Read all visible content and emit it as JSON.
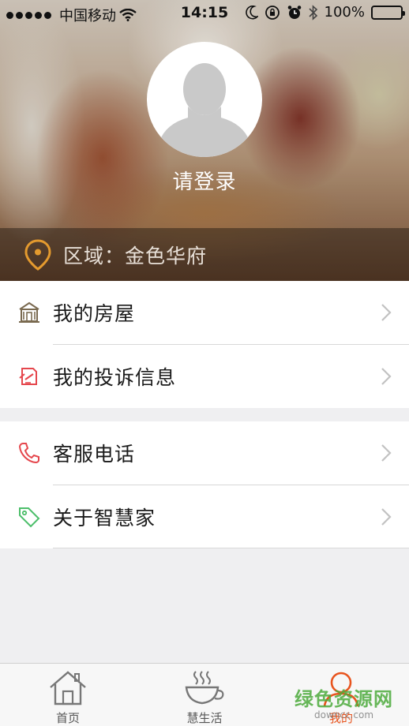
{
  "status_bar": {
    "carrier": "中国移动",
    "time": "14:15",
    "battery": "100%",
    "icons": [
      "signal-dots-icon",
      "wifi-icon",
      "moon-icon",
      "rotation-lock-icon",
      "alarm-icon",
      "bluetooth-icon",
      "battery-icon"
    ]
  },
  "profile": {
    "login_label": "请登录",
    "avatar_icon": "default-avatar-icon"
  },
  "region": {
    "label": "区域：金色华府",
    "icon": "location-pin-icon",
    "icon_color": "#e49a2e"
  },
  "menu_groups": [
    {
      "items": [
        {
          "label": "我的房屋",
          "icon": "house-icon"
        },
        {
          "label": "我的投诉信息",
          "icon": "complaint-note-icon"
        }
      ]
    },
    {
      "items": [
        {
          "label": "客服电话",
          "icon": "phone-icon"
        },
        {
          "label": "关于智慧家",
          "icon": "tag-icon"
        }
      ]
    }
  ],
  "tab_bar": {
    "tabs": [
      {
        "label": "首页",
        "icon": "home-icon",
        "active": false
      },
      {
        "label": "慧生活",
        "icon": "coffee-cup-icon",
        "active": false
      },
      {
        "label": "我的",
        "icon": "person-icon",
        "active": true
      }
    ],
    "active_color": "#e8541e"
  },
  "watermark": {
    "main": "绿色资源网",
    "sub": "downcc.com"
  }
}
